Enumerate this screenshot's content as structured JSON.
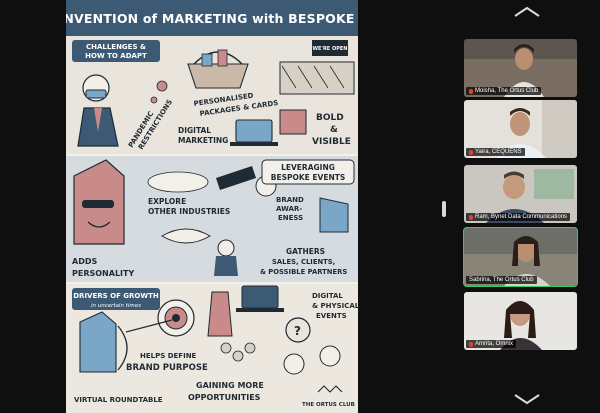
{
  "shared_screen": {
    "title": "The REINVENTION of MARKETING with BESPOKE EVENTS",
    "sections": {
      "challenges": "CHALLENGES & HOW TO ADAPT",
      "pandemic": "PANDEMIC RESTRICTIONS",
      "personalised": "PERSONALISED PACKAGES & CARDS",
      "digital": "DIGITAL MARKETING",
      "bold": "BOLD & VISIBLE",
      "explore": "EXPLORE OTHER INDUSTRIES",
      "leveraging": "LEVERAGING BESPOKE EVENTS",
      "brand_awareness": "BRAND AWARENESS",
      "adds_personality": "ADDS PERSONALITY",
      "gathers": "GATHERS SALES, CLIENTS, & POSSIBLE PARTNERS",
      "drivers": "DRIVERS OF GROWTH",
      "drivers_sub": "in uncertain times",
      "brand_purpose": "HELPS DEFINE BRAND PURPOSE",
      "digital_physical": "DIGITAL & PHYSICAL EVENTS",
      "opportunities": "GAINING MORE OPPORTUNITIES",
      "roundtable": "VIRTUAL ROUNDTABLE",
      "logo": "THE ORTUS CLUB",
      "open_sign": "WE'RE OPEN"
    }
  },
  "participants": [
    {
      "name": "Moisha, The Ortus Club",
      "active": false,
      "muted": true
    },
    {
      "name": "Yaira, CEQUENS",
      "active": false,
      "muted": true
    },
    {
      "name": "Ram, Bynet Data Communications",
      "active": false,
      "muted": true
    },
    {
      "name": "Sabrina, The Ortus Club",
      "active": true,
      "muted": false
    },
    {
      "name": "Amrita, Omnix",
      "active": false,
      "muted": true
    }
  ],
  "icons": {
    "gallery_up": "chevron-up-icon",
    "gallery_down": "chevron-down-icon",
    "splitter": "drag-handle-icon",
    "mic": "mic-muted-icon"
  },
  "colors": {
    "banner": "#3d5a74",
    "accent_pink": "#c98a8a",
    "active_speaker": "#2ecc71",
    "background": "#0f0f0f"
  }
}
